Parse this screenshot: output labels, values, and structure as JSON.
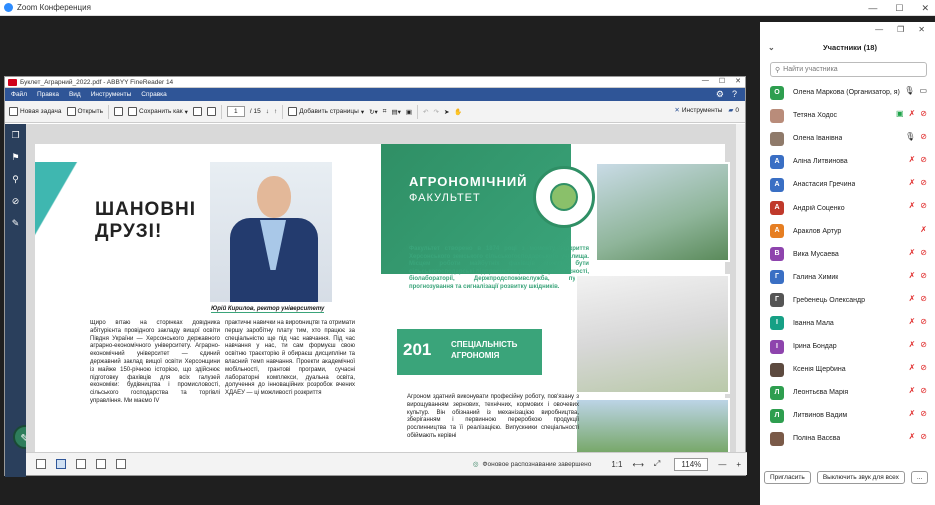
{
  "zoom": {
    "title": "Zoom Конференция",
    "win_min": "—",
    "win_max": "☐",
    "win_close": "✕"
  },
  "abbyy": {
    "title": "Буклет_Аграрний_2022.pdf - ABBYY FineReader 14",
    "menu": [
      "Файл",
      "Правка",
      "Вид",
      "Инструменты",
      "Справка"
    ],
    "toolbar": {
      "new_task": "Новая задача",
      "open": "Открыть",
      "save_as": "Сохранить как",
      "page_current": "1",
      "page_total": "/ 15",
      "add_pages": "Добавить страницы",
      "tools": "Инструменты",
      "comments_count": "0"
    },
    "status": "Фоновое распознавание завершено",
    "ratio": "1:1",
    "zoom_level": "114%"
  },
  "brochure": {
    "welcome_title_1": "ШАНОВНІ",
    "welcome_title_2": "ДРУЗІ!",
    "caption": "Юрій Кирилов, ректор університету",
    "col1": "Щиро вітаю на сторінках довідника абітурієнта провідного закладу вищої освіти Півдня України — Херсонського державного аграрно-економічного університету. Аграрно-економічний університет — єдиний державний заклад вищої освіти Херсонщини із майже 150-річною історією, що здійснює підготовку фахівців для всіх галузей економіки: будівництва і промисловості, сільського господарства та торгівлі управління. Ми маємо IV",
    "col2": "практичні навички на виробництві та отримати першу заробітну плату тим, хто працює за спеціальністю ще під час навчання. Під час навчання у нас, ти сам формуєш свою освітню траєкторію й обираєш дисципліни та власний темп навчання. Проекти академічної мобільності, грантові програми, сучасні лабораторні комплекси, дуальна освіта, долучення до інноваційних розробок вчених ХДАЕУ — ці можливості розкриття",
    "faculty_title_1": "АГРОНОМІЧНИЙ",
    "faculty_title_2": "ФАКУЛЬТЕТ",
    "faculty_text": "Факультет створено в 1874 році з моменту відкриття Херсонського земського сільськогосподарського училища. Місцем роботи майбутніх фахівців можуть бути сільськогосподарські підприємства різних форм власності, біолабораторії, Держпродспоживслужба, пункти прогнозування та сигналізації розвитку шкідників.",
    "spec_num": "201",
    "spec_label_1": "СПЕЦІАЛЬНІСТЬ",
    "spec_label_2": "АГРОНОМІЯ",
    "spec_text": "Агроном здатний виконувати професійну роботу, пов'язану з вирощуванням зернових, технічних, кормових і овочевих культур. Він обізнаний із механізацією виробництва, зберіганням і первинною переробкою продукції рослинництва та її реалізацією. Випускники спеціальності обіймають керівні"
  },
  "participants": {
    "header": "Участники (18)",
    "search_placeholder": "Найти участника",
    "list": [
      {
        "initial": "О",
        "name": "Олена Маркова (Организатор, я)",
        "color": "#2e9e4f",
        "mic": "on",
        "cam": "on"
      },
      {
        "initial": "",
        "name": "Тетяна Ходос",
        "color": "#b98c7a",
        "mic": "off",
        "cam": "off",
        "share": true
      },
      {
        "initial": "",
        "name": "Олена Іванівна",
        "color": "#8f7a6a",
        "mic": "on",
        "cam": "off"
      },
      {
        "initial": "А",
        "name": "Аліна Литвинова",
        "color": "#3a6fc4",
        "mic": "off",
        "cam": "off"
      },
      {
        "initial": "А",
        "name": "Анастасия Гречина",
        "color": "#3a6fc4",
        "mic": "off",
        "cam": "off"
      },
      {
        "initial": "А",
        "name": "Андрій Соценко",
        "color": "#c0392b",
        "mic": "off",
        "cam": "off"
      },
      {
        "initial": "А",
        "name": "Араклов Артур",
        "color": "#e67e22",
        "mic": "off",
        "cam": "none"
      },
      {
        "initial": "В",
        "name": "Вика Мусаева",
        "color": "#8e44ad",
        "mic": "off",
        "cam": "off"
      },
      {
        "initial": "Г",
        "name": "Галина Химик",
        "color": "#3a6fc4",
        "mic": "off",
        "cam": "off"
      },
      {
        "initial": "Г",
        "name": "Гребенець Олександр",
        "color": "#555555",
        "mic": "off",
        "cam": "off"
      },
      {
        "initial": "І",
        "name": "Іванна Мала",
        "color": "#16a085",
        "mic": "off",
        "cam": "off"
      },
      {
        "initial": "І",
        "name": "Ірина Бондар",
        "color": "#8e44ad",
        "mic": "off",
        "cam": "off"
      },
      {
        "initial": "",
        "name": "Ксенія Щербина",
        "color": "#5d4a3f",
        "mic": "off",
        "cam": "off"
      },
      {
        "initial": "Л",
        "name": "Леонтьєва Марія",
        "color": "#2e9e4f",
        "mic": "off",
        "cam": "off"
      },
      {
        "initial": "Л",
        "name": "Литвинов Вадим",
        "color": "#2e9e4f",
        "mic": "off",
        "cam": "off"
      },
      {
        "initial": "",
        "name": "Поліна Васєва",
        "color": "#7a5a48",
        "mic": "off",
        "cam": "off"
      }
    ],
    "invite": "Пригласить",
    "mute_all": "Выключить звук для всех",
    "more": "..."
  }
}
